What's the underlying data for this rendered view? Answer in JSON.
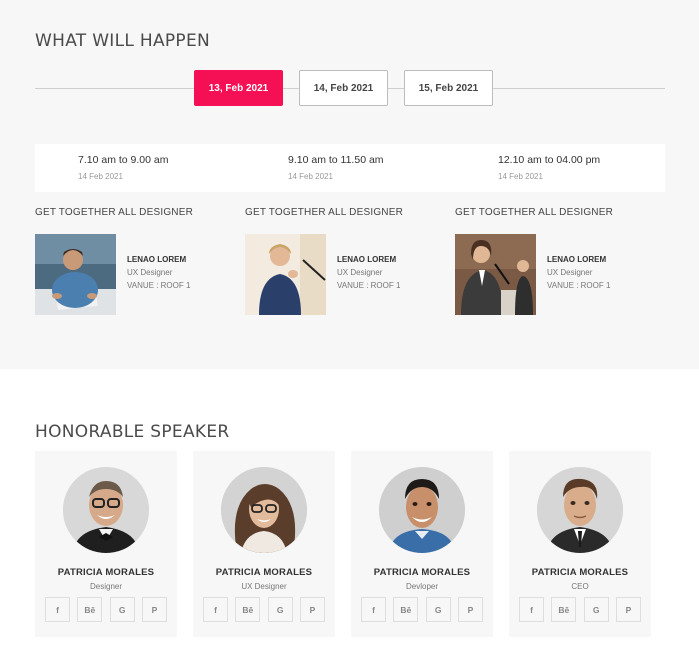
{
  "schedule": {
    "title": "WHAT WILL HAPPEN",
    "dates": [
      "13, Feb 2021",
      "14, Feb 2021",
      "15, Feb 2021"
    ],
    "active_date_index": 0,
    "slots": [
      {
        "time": "7.10 am to 9.00 am",
        "date": "14 Feb 2021"
      },
      {
        "time": "9.10 am to 11.50 am",
        "date": "14 Feb 2021"
      },
      {
        "time": "12.10 am to 04.00 pm",
        "date": "14 Feb 2021"
      }
    ],
    "events": [
      {
        "title": "GET TOGETHER ALL DESIGNER",
        "name": "LENAO LOREM",
        "role": "UX Designer",
        "venue": "VANUE : ROOF 1"
      },
      {
        "title": "GET TOGETHER ALL DESIGNER",
        "name": "LENAO LOREM",
        "role": "UX Designer",
        "venue": "VANUE : ROOF 1"
      },
      {
        "title": "GET TOGETHER ALL DESIGNER",
        "name": "LENAO LOREM",
        "role": "UX Designer",
        "venue": "VANUE : ROOF 1"
      }
    ]
  },
  "speakers": {
    "title": "HONORABLE SPEAKER",
    "social_labels": [
      "f",
      "Bē",
      "G",
      "P"
    ],
    "social_icons": [
      "facebook-icon",
      "behance-icon",
      "google-icon",
      "pinterest-icon"
    ],
    "items": [
      {
        "name": "PATRICIA MORALES",
        "role": "Designer"
      },
      {
        "name": "PATRICIA MORALES",
        "role": "UX Designer"
      },
      {
        "name": "PATRICIA MORALES",
        "role": "Devloper"
      },
      {
        "name": "PATRICIA MORALES",
        "role": "CEO"
      }
    ]
  },
  "colors": {
    "accent": "#f50f55",
    "section_bg": "#f7f7f7"
  }
}
